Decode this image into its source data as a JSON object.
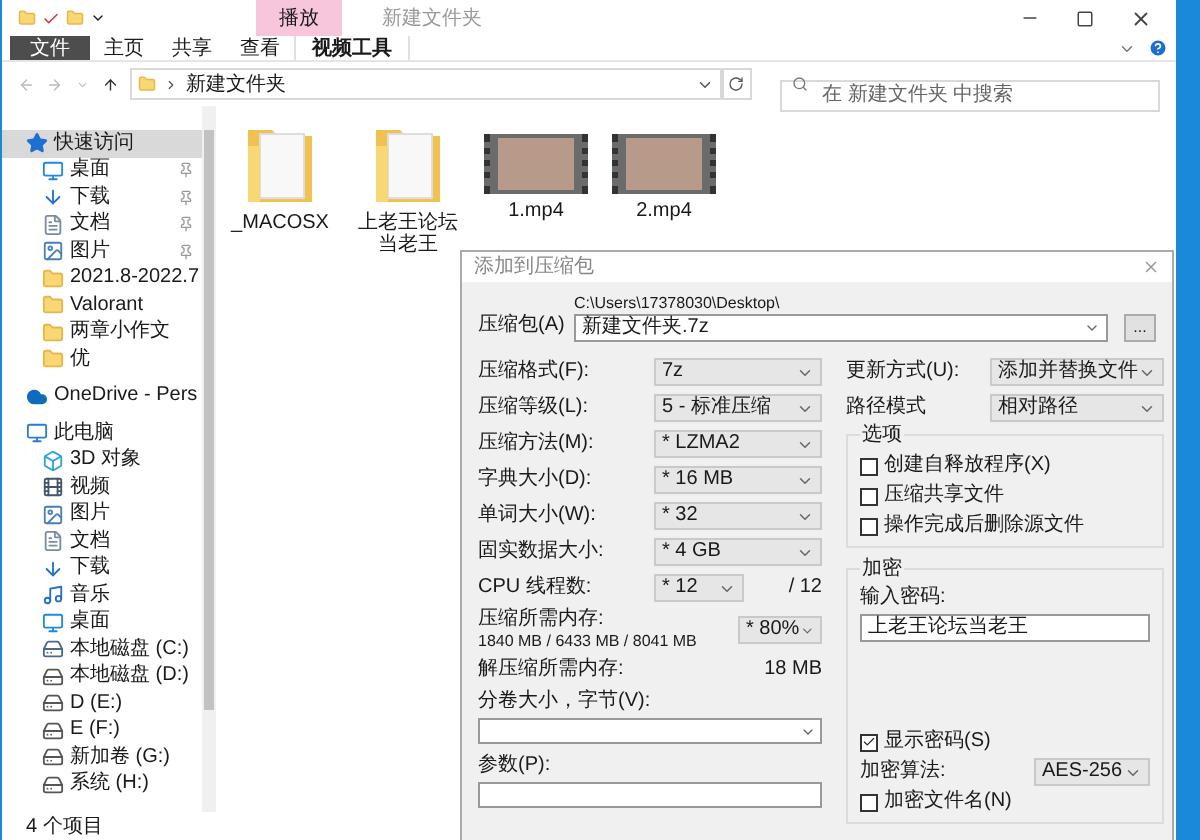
{
  "window": {
    "title": "新建文件夹",
    "context_tab": "播放"
  },
  "ribbon_tabs": [
    {
      "label": "文件",
      "kind": "file",
      "selected": false
    },
    {
      "label": "主页",
      "kind": "tab",
      "selected": false
    },
    {
      "label": "共享",
      "kind": "tab",
      "selected": false
    },
    {
      "label": "查看",
      "kind": "tab",
      "selected": false
    },
    {
      "label": "视频工具",
      "kind": "context",
      "selected": true
    }
  ],
  "address": {
    "path": "新建文件夹",
    "search_placeholder": "在 新建文件夹 中搜索"
  },
  "sidebar": {
    "items": [
      {
        "label": "快速访问",
        "kind": "quick",
        "selected": true,
        "children": [
          {
            "label": "桌面",
            "kind": "desktop",
            "pinned": true,
            "selected": false
          },
          {
            "label": "下载",
            "kind": "download",
            "pinned": true,
            "selected": false
          },
          {
            "label": "文档",
            "kind": "document",
            "pinned": true,
            "selected": false
          },
          {
            "label": "图片",
            "kind": "picture",
            "pinned": true,
            "selected": false
          },
          {
            "label": "2021.8-2022.7",
            "kind": "folder",
            "pinned": false,
            "selected": false
          },
          {
            "label": "Valorant",
            "kind": "folder",
            "pinned": false,
            "selected": false
          },
          {
            "label": "两章小作文",
            "kind": "folder",
            "pinned": false,
            "selected": false
          },
          {
            "label": "优",
            "kind": "folder",
            "pinned": false,
            "selected": false
          }
        ]
      },
      {
        "label": "OneDrive - Pers",
        "kind": "cloud",
        "selected": false
      },
      {
        "label": "此电脑",
        "kind": "pc",
        "selected": false,
        "children": [
          {
            "label": "3D 对象",
            "kind": "objects",
            "pinned": false,
            "selected": false
          },
          {
            "label": "视频",
            "kind": "video",
            "pinned": false,
            "selected": false
          },
          {
            "label": "图片",
            "kind": "picture",
            "pinned": false,
            "selected": false
          },
          {
            "label": "文档",
            "kind": "document",
            "pinned": false,
            "selected": false
          },
          {
            "label": "下载",
            "kind": "download",
            "pinned": false,
            "selected": false
          },
          {
            "label": "音乐",
            "kind": "music",
            "pinned": false,
            "selected": false
          },
          {
            "label": "桌面",
            "kind": "desktop",
            "pinned": false,
            "selected": false
          },
          {
            "label": "本地磁盘 (C:)",
            "kind": "system-drive",
            "pinned": false,
            "selected": false
          },
          {
            "label": "本地磁盘 (D:)",
            "kind": "drive",
            "pinned": false,
            "selected": false
          },
          {
            "label": "D (E:)",
            "kind": "drive",
            "pinned": false,
            "selected": false
          },
          {
            "label": "E (F:)",
            "kind": "drive",
            "pinned": false,
            "selected": false
          },
          {
            "label": "新加卷 (G:)",
            "kind": "drive",
            "pinned": false,
            "selected": false
          },
          {
            "label": "系统 (H:)",
            "kind": "drive",
            "pinned": false,
            "selected": false
          }
        ]
      }
    ]
  },
  "files": [
    {
      "name": "_MACOSX",
      "kind": "folder"
    },
    {
      "name": "上老王论坛当老王",
      "kind": "folder"
    },
    {
      "name": "1.mp4",
      "kind": "video"
    },
    {
      "name": "2.mp4",
      "kind": "video"
    }
  ],
  "status_bar": {
    "count": "4 个项目"
  },
  "dialog": {
    "title": "添加到压缩包",
    "archive": {
      "label": "压缩包(A)",
      "path": "C:\\Users\\17378030\\Desktop\\",
      "value": "新建文件夹.7z",
      "browse": "..."
    },
    "left_rows": [
      {
        "kind": "select",
        "label": "压缩格式(F):",
        "value": "7z"
      },
      {
        "kind": "select",
        "label": "压缩等级(L):",
        "value": "5 - 标准压缩"
      },
      {
        "kind": "select",
        "label": "压缩方法(M):",
        "value": "* LZMA2"
      },
      {
        "kind": "select",
        "label": "字典大小(D):",
        "value": "* 16 MB"
      },
      {
        "kind": "select",
        "label": "单词大小(W):",
        "value": "* 32"
      },
      {
        "kind": "select",
        "label": "固实数据大小:",
        "value": "* 4 GB"
      },
      {
        "kind": "cpu",
        "label": "CPU 线程数:",
        "value": "* 12",
        "suffix": "/ 12"
      },
      {
        "kind": "memory",
        "label": "压缩所需内存:",
        "detail": "1840 MB / 6433 MB / 8041 MB",
        "value": "* 80%"
      },
      {
        "kind": "readout",
        "label": "解压缩所需内存:",
        "value": "18 MB"
      },
      {
        "kind": "combo",
        "label": "分卷大小，字节(V):"
      },
      {
        "kind": "input",
        "label": "参数(P):"
      }
    ],
    "right_rows": [
      {
        "label": "更新方式(U):",
        "value": "添加并替换文件"
      },
      {
        "label": "路径模式",
        "value": "相对路径"
      }
    ],
    "options": {
      "title": "选项",
      "items": [
        {
          "label": "创建自释放程序(X)",
          "checked": false
        },
        {
          "label": "压缩共享文件",
          "checked": false
        },
        {
          "label": "操作完成后删除源文件",
          "checked": false
        }
      ]
    },
    "encryption": {
      "title": "加密",
      "password_label": "输入密码:",
      "password": "上老王论坛当老王",
      "show_password": {
        "label": "显示密码(S)",
        "checked": true
      },
      "method_label": "加密算法:",
      "method": "AES-256",
      "encrypt_names": {
        "label": "加密文件名(N)",
        "checked": false
      }
    }
  }
}
